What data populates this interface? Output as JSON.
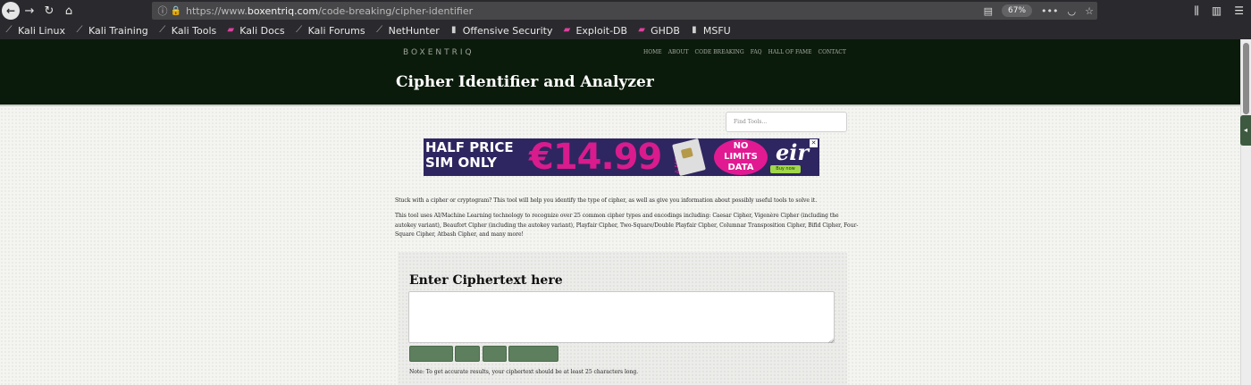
{
  "browser": {
    "url_prefix": "https://www.",
    "url_domain": "boxentriq.com",
    "url_path": "/code-breaking/cipher-identifier",
    "zoom": "67%",
    "bookmarks": [
      {
        "label": "Kali Linux",
        "icon": "dragon-icon"
      },
      {
        "label": "Kali Training",
        "icon": "dragon-icon"
      },
      {
        "label": "Kali Tools",
        "icon": "dragon-icon"
      },
      {
        "label": "Kali Docs",
        "icon": "pink-doc-icon"
      },
      {
        "label": "Kali Forums",
        "icon": "dragon-icon"
      },
      {
        "label": "NetHunter",
        "icon": "dragon-icon"
      },
      {
        "label": "Offensive Security",
        "icon": "doc-icon"
      },
      {
        "label": "Exploit-DB",
        "icon": "pink-doc-icon"
      },
      {
        "label": "GHDB",
        "icon": "pink-doc-icon"
      },
      {
        "label": "MSFU",
        "icon": "doc-icon"
      }
    ]
  },
  "site": {
    "logo": "BOXENTRIQ",
    "menu": [
      "HOME",
      "ABOUT",
      "CODE BREAKING",
      "FAQ",
      "HALL OF FAME",
      "CONTACT"
    ],
    "title": "Cipher Identifier and Analyzer",
    "search_placeholder": "Find Tools..."
  },
  "ad": {
    "line1": "HALF PRICE",
    "line2": "SIM ONLY",
    "price": "€14.99",
    "per": "A MONTH",
    "badge_line1": "NO",
    "badge_line2": "LIMITS",
    "badge_line3": "DATA",
    "brand": "eir",
    "cta": "Buy now",
    "accent": "#d91b8d",
    "bg": "#2e2660"
  },
  "intro": {
    "p1": "Stuck with a cipher or cryptogram? This tool will help you identify the type of cipher, as well as give you information about possibly useful tools to solve it.",
    "p2": "This tool uses AI/Machine Learning technology to recognize over 25 common cipher types and encodings including: Caesar Cipher, Vigenère Cipher (including the autokey variant), Beaufort Cipher (including the autokey variant), Playfair Cipher, Two-Square/Double Playfair Cipher, Columnar Transposition Cipher, Bifid Cipher, Four-Square Cipher, Atbash Cipher, and many more!"
  },
  "panel": {
    "heading": "Enter Ciphertext here",
    "ciphertext": "",
    "note": "Note: To get accurate results, your ciphertext should be at least 25 characters long."
  },
  "colors": {
    "header_bg": "#0b1b0b",
    "button_bg": "#5e7f5e"
  }
}
